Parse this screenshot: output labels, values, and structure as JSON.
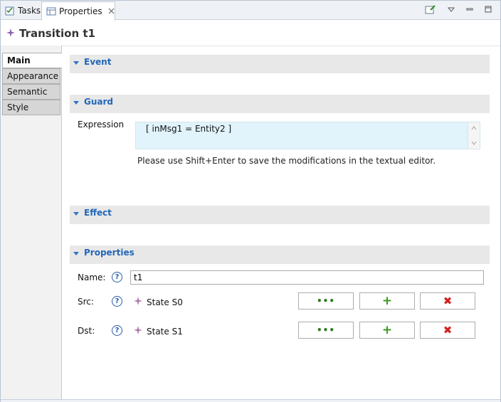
{
  "tabs": [
    {
      "label": "Tasks",
      "icon": "tasks-icon"
    },
    {
      "label": "Properties",
      "icon": "properties-icon",
      "active": true
    }
  ],
  "title": "Transition t1",
  "nav": [
    {
      "label": "Main",
      "active": true
    },
    {
      "label": "Appearance"
    },
    {
      "label": "Semantic"
    },
    {
      "label": "Style"
    }
  ],
  "sections": {
    "event": "Event",
    "guard": "Guard",
    "effect": "Effect",
    "properties": "Properties"
  },
  "guard": {
    "expression_label": "Expression",
    "expression_value": "[ inMsg1 = Entity2 ]",
    "hint": "Please use Shift+Enter to save the modifications in the textual editor."
  },
  "props": {
    "name_label": "Name:",
    "name_value": "t1",
    "src_label": "Src:",
    "src_value": "State S0",
    "dst_label": "Dst:",
    "dst_value": "State S1",
    "help_glyph": "?",
    "browse_glyph": "•••",
    "add_glyph": "+",
    "remove_glyph": "✖"
  },
  "colors": {
    "section_header": "#2367b8",
    "section_bg": "#e8e8e8",
    "expression_bg": "#e1f3fb",
    "add_green": "#3a9a1f",
    "remove_red": "#d42020"
  }
}
